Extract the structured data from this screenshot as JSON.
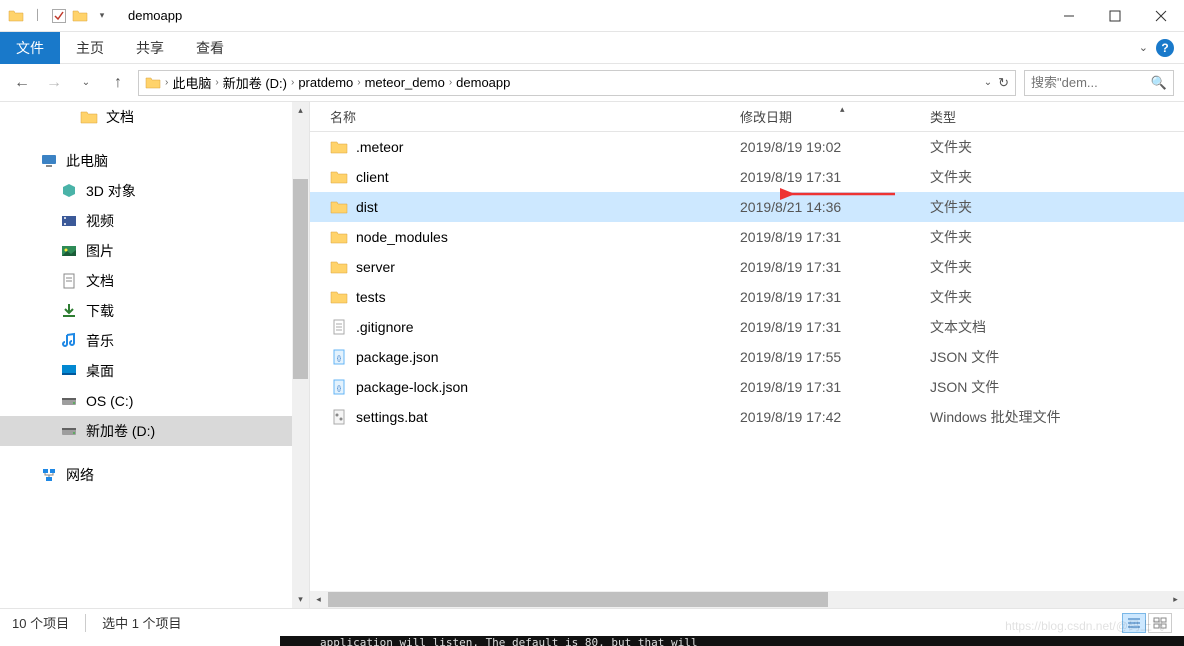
{
  "window": {
    "title": "demoapp"
  },
  "ribbon": {
    "file": "文件",
    "home": "主页",
    "share": "共享",
    "view": "查看"
  },
  "breadcrumbs": [
    "此电脑",
    "新加卷 (D:)",
    "pratdemo",
    "meteor_demo",
    "demoapp"
  ],
  "search": {
    "placeholder": "搜索\"dem..."
  },
  "sidebar": {
    "items": [
      {
        "label": "文档",
        "indent": 80,
        "icon": "folder"
      },
      {
        "label": "",
        "indent": 0,
        "icon": "spacer"
      },
      {
        "label": "此电脑",
        "indent": 40,
        "icon": "pc"
      },
      {
        "label": "3D 对象",
        "indent": 60,
        "icon": "3d"
      },
      {
        "label": "视频",
        "indent": 60,
        "icon": "video"
      },
      {
        "label": "图片",
        "indent": 60,
        "icon": "pictures"
      },
      {
        "label": "文档",
        "indent": 60,
        "icon": "docs"
      },
      {
        "label": "下载",
        "indent": 60,
        "icon": "downloads"
      },
      {
        "label": "音乐",
        "indent": 60,
        "icon": "music"
      },
      {
        "label": "桌面",
        "indent": 60,
        "icon": "desktop"
      },
      {
        "label": "OS (C:)",
        "indent": 60,
        "icon": "drive"
      },
      {
        "label": "新加卷 (D:)",
        "indent": 60,
        "icon": "drive",
        "selected": true
      },
      {
        "label": "",
        "indent": 0,
        "icon": "spacer"
      },
      {
        "label": "网络",
        "indent": 40,
        "icon": "network"
      }
    ]
  },
  "columns": {
    "name": "名称",
    "date": "修改日期",
    "type": "类型"
  },
  "files": [
    {
      "name": ".meteor",
      "date": "2019/8/19 19:02",
      "type": "文件夹",
      "icon": "folder"
    },
    {
      "name": "client",
      "date": "2019/8/19 17:31",
      "type": "文件夹",
      "icon": "folder"
    },
    {
      "name": "dist",
      "date": "2019/8/21 14:36",
      "type": "文件夹",
      "icon": "folder",
      "selected": true
    },
    {
      "name": "node_modules",
      "date": "2019/8/19 17:31",
      "type": "文件夹",
      "icon": "folder"
    },
    {
      "name": "server",
      "date": "2019/8/19 17:31",
      "type": "文件夹",
      "icon": "folder"
    },
    {
      "name": "tests",
      "date": "2019/8/19 17:31",
      "type": "文件夹",
      "icon": "folder"
    },
    {
      "name": ".gitignore",
      "date": "2019/8/19 17:31",
      "type": "文本文档",
      "icon": "text"
    },
    {
      "name": "package.json",
      "date": "2019/8/19 17:55",
      "type": "JSON 文件",
      "icon": "json"
    },
    {
      "name": "package-lock.json",
      "date": "2019/8/19 17:31",
      "type": "JSON 文件",
      "icon": "json"
    },
    {
      "name": "settings.bat",
      "date": "2019/8/19 17:42",
      "type": "Windows 批处理文件",
      "icon": "bat"
    }
  ],
  "status": {
    "count": "10 个项目",
    "selected": "选中 1 个项目"
  },
  "watermark": "https://blog.csdn.net/@码上飞",
  "terminal_snippet": "application will listen. The default is 80, but that will"
}
